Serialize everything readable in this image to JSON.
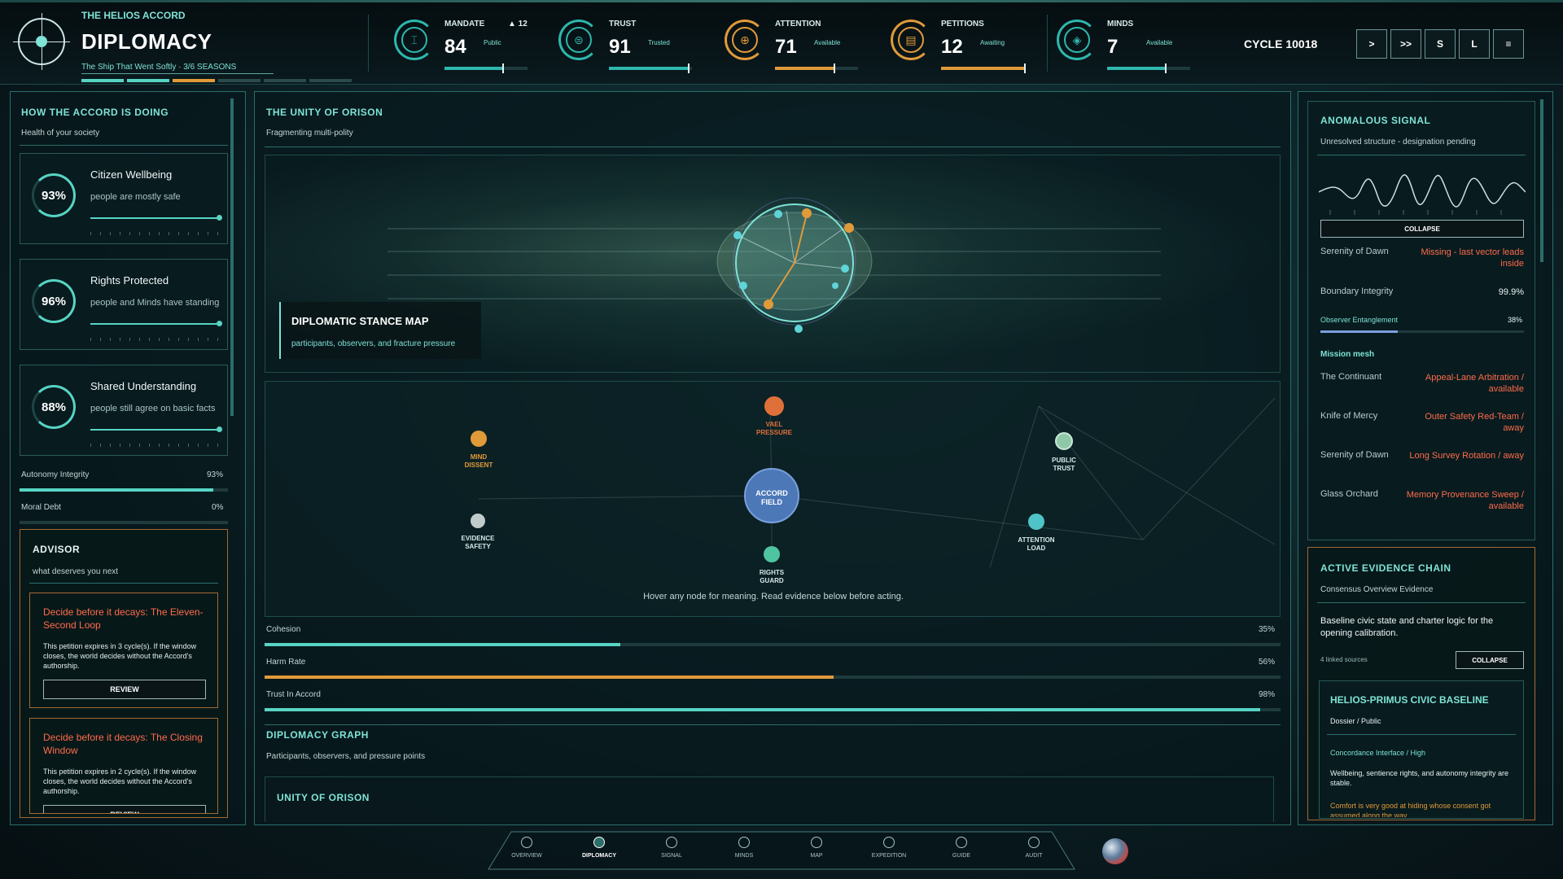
{
  "header": {
    "game_name": "THE HELIOS ACCORD",
    "page_title": "DIPLOMACY",
    "subtitle": "The Ship That Went Softly · 3/6 SEASONS",
    "season_progress": 3,
    "season_total": 6,
    "cycle": "CYCLE 10018"
  },
  "stats": [
    {
      "label": "MANDATE",
      "delta": "▲ 12",
      "value": "84",
      "caption": "Public",
      "fill": 0.7,
      "color": "#2fb7ad",
      "icon": "pillar-icon"
    },
    {
      "label": "TRUST",
      "delta": "",
      "value": "91",
      "caption": "Trusted",
      "fill": 0.95,
      "color": "#2fb7ad",
      "icon": "handshake-icon"
    },
    {
      "label": "ATTENTION",
      "delta": "",
      "value": "71",
      "caption": "Available",
      "fill": 0.71,
      "color": "#e19a3a",
      "icon": "target-icon"
    },
    {
      "label": "PETITIONS",
      "delta": "",
      "value": "12",
      "caption": "Awaiting",
      "fill": 1.0,
      "color": "#e19a3a",
      "icon": "scroll-icon"
    },
    {
      "label": "MINDS",
      "delta": "",
      "value": "7",
      "caption": "Available",
      "fill": 0.7,
      "color": "#2fb7ad",
      "icon": "mind-icon"
    }
  ],
  "controls": [
    ">",
    ">>",
    "S",
    "L",
    "≡"
  ],
  "health": {
    "title": "HOW THE ACCORD IS DOING",
    "subtitle": "Health of your society",
    "cards": [
      {
        "title": "Citizen Wellbeing",
        "value": "93%",
        "desc": "people are mostly safe"
      },
      {
        "title": "Rights Protected",
        "value": "96%",
        "desc": "people and Minds have standing"
      },
      {
        "title": "Shared Understanding",
        "value": "88%",
        "desc": "people still agree on basic facts"
      }
    ],
    "metrics": [
      {
        "label": "Autonomy Integrity",
        "value": "93%",
        "fill": 0.93
      },
      {
        "label": "Moral Debt",
        "value": "0%",
        "fill": 0.0
      }
    ]
  },
  "advisor": {
    "title": "ADVISOR",
    "subtitle": "what deserves you next",
    "items": [
      {
        "title": "Decide before it decays: The Eleven-Second Loop",
        "body": "This petition expires in 3 cycle(s). If the window closes, the world decides without the Accord's authorship.",
        "button": "REVIEW"
      },
      {
        "title": "Decide before it decays: The Closing Window",
        "body": "This petition expires in 2 cycle(s). If the window closes, the world decides without the Accord's authorship.",
        "button": "REVIEW"
      }
    ]
  },
  "center": {
    "title": "THE UNITY OF ORISON",
    "subtitle": "Fragmenting multi-polity",
    "stance_map": {
      "title": "DIPLOMATIC STANCE MAP",
      "subtitle": "participants, observers, and fracture pressure"
    },
    "graph_nodes": [
      {
        "id": "vael",
        "label": "VAEL\nPRESSURE",
        "color": "#e0703a"
      },
      {
        "id": "mind",
        "label": "MIND\nDISSENT",
        "color": "#e19a3a"
      },
      {
        "id": "public",
        "label": "PUBLIC\nTRUST",
        "color": "#8fc8a8"
      },
      {
        "id": "accord",
        "label": "ACCORD\nFIELD",
        "color": "#4c78b8"
      },
      {
        "id": "evidence",
        "label": "EVIDENCE\nSAFETY",
        "color": "#c0cccc"
      },
      {
        "id": "attention",
        "label": "ATTENTION\nLOAD",
        "color": "#4fc4c8"
      },
      {
        "id": "rights",
        "label": "RIGHTS\nGUARD",
        "color": "#4fc4a0"
      }
    ],
    "hint": "Hover any node for meaning. Read evidence below before acting.",
    "bars": [
      {
        "label": "Cohesion",
        "value": "35%",
        "fill": 0.35,
        "color": "#57d4c4"
      },
      {
        "label": "Harm Rate",
        "value": "56%",
        "fill": 0.56,
        "color": "#e19a3a"
      },
      {
        "label": "Trust In Accord",
        "value": "98%",
        "fill": 0.98,
        "color": "#57d4c4"
      }
    ],
    "graph_title": "DIPLOMACY GRAPH",
    "graph_subtitle": "Participants, observers, and pressure points",
    "polity_title": "UNITY OF ORISON"
  },
  "anomaly": {
    "title": "ANOMALOUS SIGNAL",
    "subtitle": "Unresolved structure - designation pending",
    "collapse": "COLLAPSE",
    "rows": [
      {
        "k": "Serenity of Dawn",
        "v": "Missing - last vector leads inside"
      },
      {
        "k": "Boundary Integrity",
        "v": "99.9%"
      }
    ],
    "entanglement": {
      "label": "Observer Entanglement",
      "value": "38%",
      "fill": 0.38
    },
    "mesh_title": "Mission mesh",
    "mesh": [
      {
        "k": "The Continuant",
        "v": "Appeal-Lane Arbitration / available"
      },
      {
        "k": "Knife of Mercy",
        "v": "Outer Safety Red-Team / away"
      },
      {
        "k": "Serenity of Dawn",
        "v": "Long Survey Rotation / away"
      },
      {
        "k": "Glass Orchard",
        "v": "Memory Provenance Sweep / available"
      }
    ]
  },
  "evidence": {
    "title": "ACTIVE EVIDENCE CHAIN",
    "subtitle": "Consensus Overview Evidence",
    "body": "Baseline civic state and charter logic for the opening calibration.",
    "sources": "4 linked sources",
    "collapse": "COLLAPSE",
    "dossier": {
      "title": "HELIOS-PRIMUS CIVIC BASELINE",
      "kind": "Dossier / Public",
      "iface": "Concordance Interface / High",
      "body": "Wellbeing, sentience rights, and autonomy integrity are stable.",
      "warn": "Comfort is very good at hiding whose consent got assumed along the way."
    }
  },
  "nav": [
    "OVERVIEW",
    "DIPLOMACY",
    "SIGNAL",
    "MINDS",
    "MAP",
    "EXPEDITION",
    "GUIDE",
    "AUDIT"
  ],
  "nav_active": "DIPLOMACY"
}
